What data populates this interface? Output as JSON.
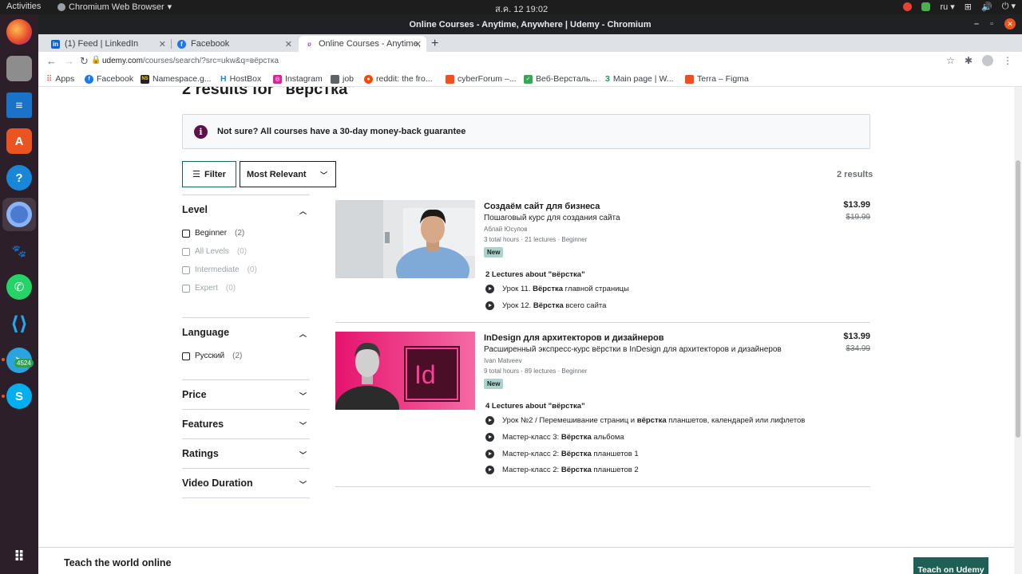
{
  "os": {
    "activities": "Activities",
    "app_name": "Chromium Web Browser",
    "clock": "ส.ค. 12  19:02",
    "lang": "ru",
    "telegram_badge": "4524"
  },
  "window": {
    "title": "Online Courses - Anytime, Anywhere | Udemy - Chromium"
  },
  "tabs": [
    {
      "label": "(1) Feed | LinkedIn"
    },
    {
      "label": "Facebook"
    },
    {
      "label": "Online Courses - Anytime,"
    }
  ],
  "omnibox": {
    "host": "udemy.com",
    "path": "/courses/search/?src=ukw&q=вёрстка"
  },
  "bookmarks": [
    {
      "label": "Apps"
    },
    {
      "label": "Facebook"
    },
    {
      "label": "Namespace.g..."
    },
    {
      "label": "HostBox"
    },
    {
      "label": "Instagram"
    },
    {
      "label": "job"
    },
    {
      "label": "reddit: the fro..."
    },
    {
      "label": "cyberForum –..."
    },
    {
      "label": "Веб-Версталь..."
    },
    {
      "label": "Main page | W..."
    },
    {
      "label": "Terra – Figma"
    }
  ],
  "search": {
    "heading": "2 results for \"вёрстка\"",
    "notice": "Not sure? All courses have a 30-day money-back guarantee",
    "filter_label": "Filter",
    "sort_label": "Most Relevant",
    "results_count": "2 results"
  },
  "sidebar": {
    "level": {
      "title": "Level",
      "options": [
        {
          "label": "Beginner",
          "count": "(2)"
        },
        {
          "label": "All Levels",
          "count": "(0)"
        },
        {
          "label": "Intermediate",
          "count": "(0)"
        },
        {
          "label": "Expert",
          "count": "(0)"
        }
      ]
    },
    "language": {
      "title": "Language",
      "options": [
        {
          "label": "Русский",
          "count": "(2)"
        }
      ]
    },
    "price": "Price",
    "features": "Features",
    "ratings": "Ratings",
    "duration": "Video Duration"
  },
  "courses": [
    {
      "title": "Создаём сайт для бизнеса",
      "subtitle": "Пошаговый курс для создания сайта",
      "instructor": "Аблай Юсупов",
      "meta": "3 total hours · 21 lectures · Beginner",
      "badge": "New",
      "price": "$13.99",
      "old_price": "$19.99",
      "lectures_header": "2 Lectures about \"вёрстка\"",
      "lectures": [
        {
          "pre": "Урок 11. ",
          "bold": "Вёрстка",
          "post": " главной страницы"
        },
        {
          "pre": "Урок 12. ",
          "bold": "Вёрстка",
          "post": " всего сайта"
        }
      ]
    },
    {
      "title": "InDesign для архитекторов и дизайнеров",
      "subtitle": "Расширенный экспресс-курс вёрстки в InDesign для архитекторов и дизайнеров",
      "instructor": "Ivan Matveev",
      "meta": "9 total hours · 89 lectures · Beginner",
      "badge": "New",
      "price": "$13.99",
      "old_price": "$34.99",
      "thumb_logo": "Id",
      "lectures_header": "4 Lectures about \"вёрстка\"",
      "lectures": [
        {
          "pre": "Урок №2 / Перемешивание страниц и ",
          "bold": "вёрстка",
          "post": " планшетов, календарей или лифлетов"
        },
        {
          "pre": "Мастер-класс 3: ",
          "bold": "Вёрстка",
          "post": " альбома"
        },
        {
          "pre": "Мастер-класс 2: ",
          "bold": "Вёрстка",
          "post": " планшетов 1"
        },
        {
          "pre": "Мастер-класс 2: ",
          "bold": "Вёрстка",
          "post": " планшетов 2"
        }
      ]
    }
  ],
  "footer": {
    "text": "Teach the world online",
    "button": "Teach on Udemy"
  },
  "colors": {
    "udemy_green": "#1e6055",
    "badge_new": "#acd2cc",
    "notice_icon": "#5d1049",
    "indesign_pink": "#f0307e"
  }
}
